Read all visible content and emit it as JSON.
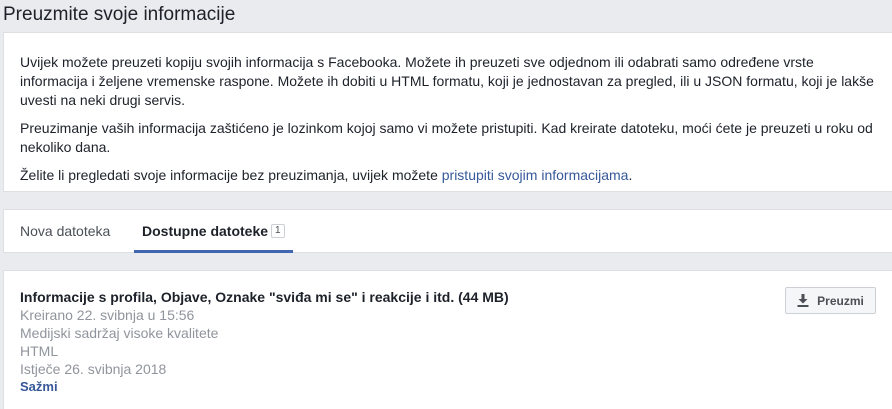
{
  "page": {
    "title": "Preuzmite svoje informacije"
  },
  "intro": {
    "paragraph1": "Uvijek možete preuzeti kopiju svojih informacija s Facebooka. Možete ih preuzeti sve odjednom ili odabrati samo određene vrste informacija i željene vremenske raspone. Možete ih dobiti u HTML formatu, koji je jednostavan za pregled, ili u JSON formatu, koji je lakše uvesti na neki drugi servis.",
    "paragraph2": "Preuzimanje vaših informacija zaštićeno je lozinkom kojoj samo vi možete pristupiti. Kad kreirate datoteku, moći ćete je preuzeti u roku od nekoliko dana.",
    "paragraph3_text": "Želite li pregledati svoje informacije bez preuzimanja, uvijek možete ",
    "paragraph3_link": "pristupiti svojim informacijama",
    "paragraph3_end": "."
  },
  "tabs": [
    {
      "label": "Nova datoteka",
      "active": false
    },
    {
      "label": "Dostupne datoteke",
      "active": true,
      "count": "1"
    }
  ],
  "file": {
    "title": "Informacije s profila, Objave, Oznake \"sviđa mi se\" i reakcije i itd. (44 MB)",
    "created": "Kreirano 22. svibnja u 15:56",
    "quality": "Medijski sadržaj visoke kvalitete",
    "format": "HTML",
    "expires": "Istječe 26. svibnja 2018",
    "collapse_label": "Sažmi",
    "download_label": "Preuzmi",
    "download_icon": "download-icon"
  },
  "colors": {
    "link": "#365899",
    "tab_underline": "#4267b2",
    "background": "#e9ebee"
  }
}
